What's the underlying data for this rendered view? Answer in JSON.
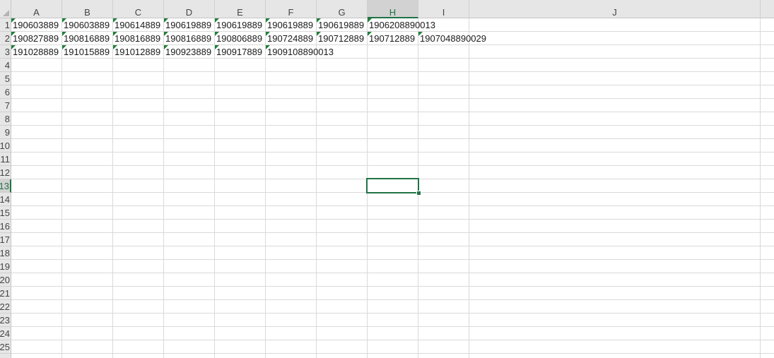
{
  "sheet": {
    "columns": [
      "A",
      "B",
      "C",
      "D",
      "E",
      "F",
      "G",
      "H",
      "I",
      "J"
    ],
    "active_column": "H",
    "rows": [
      "1",
      "2",
      "3",
      "4",
      "5",
      "6",
      "7",
      "8",
      "9",
      "10",
      "11",
      "12",
      "13",
      "14",
      "15",
      "16",
      "17",
      "18",
      "19",
      "20",
      "21",
      "22",
      "23",
      "24",
      "25"
    ],
    "active_row": "13",
    "cells": {
      "r1": [
        "190603889",
        "190603889",
        "190614889",
        "190619889",
        "190619889",
        "190619889",
        "190619889",
        "1906208890013"
      ],
      "r2": [
        "190827889",
        "190816889",
        "190816889",
        "190816889",
        "190806889",
        "190724889",
        "190712889",
        "190712889",
        "1907048890029"
      ],
      "r3": [
        "191028889",
        "191015889",
        "191012889",
        "190923889",
        "190917889",
        "1909108890013"
      ]
    },
    "flag_color": "#1f7f3a",
    "accent_color": "#217346",
    "selected_cell": "H13"
  }
}
